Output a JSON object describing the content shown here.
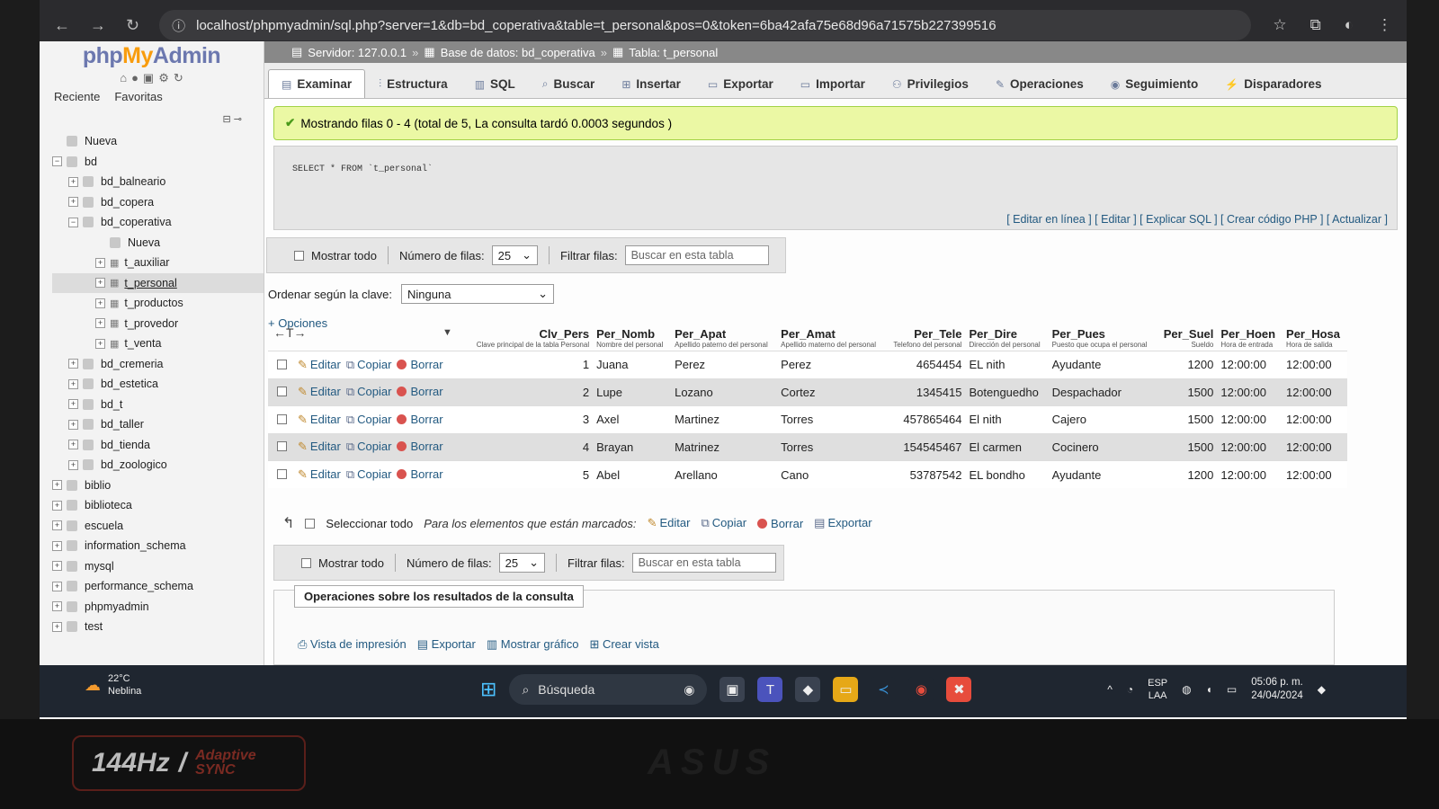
{
  "browser": {
    "url": "localhost/phpmyadmin/sql.php?server=1&db=bd_coperativa&table=t_personal&pos=0&token=6ba42afa75e68d96a71575b227399516"
  },
  "sidebar": {
    "logo_php": "php",
    "logo_my": "My",
    "logo_admin": "Admin",
    "links": [
      "Reciente",
      "Favoritas"
    ],
    "tree": [
      {
        "label": "Nueva",
        "level": 0,
        "type": "new"
      },
      {
        "label": "bd",
        "level": 0,
        "type": "db",
        "expanded": true
      },
      {
        "label": "bd_balneario",
        "level": 1,
        "type": "db"
      },
      {
        "label": "bd_copera",
        "level": 1,
        "type": "db"
      },
      {
        "label": "bd_coperativa",
        "level": 1,
        "type": "db",
        "expanded": true
      },
      {
        "label": "Nueva",
        "level": 2,
        "type": "new"
      },
      {
        "label": "t_auxiliar",
        "level": 2,
        "type": "table"
      },
      {
        "label": "t_personal",
        "level": 2,
        "type": "table",
        "selected": true
      },
      {
        "label": "t_productos",
        "level": 2,
        "type": "table"
      },
      {
        "label": "t_provedor",
        "level": 2,
        "type": "table"
      },
      {
        "label": "t_venta",
        "level": 2,
        "type": "table"
      },
      {
        "label": "bd_cremeria",
        "level": 1,
        "type": "db"
      },
      {
        "label": "bd_estetica",
        "level": 1,
        "type": "db"
      },
      {
        "label": "bd_t",
        "level": 1,
        "type": "db"
      },
      {
        "label": "bd_taller",
        "level": 1,
        "type": "db"
      },
      {
        "label": "bd_tienda",
        "level": 1,
        "type": "db"
      },
      {
        "label": "bd_zoologico",
        "level": 1,
        "type": "db"
      },
      {
        "label": "biblio",
        "level": 0,
        "type": "db"
      },
      {
        "label": "biblioteca",
        "level": 0,
        "type": "db"
      },
      {
        "label": "escuela",
        "level": 0,
        "type": "db"
      },
      {
        "label": "information_schema",
        "level": 0,
        "type": "db"
      },
      {
        "label": "mysql",
        "level": 0,
        "type": "db"
      },
      {
        "label": "performance_schema",
        "level": 0,
        "type": "db"
      },
      {
        "label": "phpmyadmin",
        "level": 0,
        "type": "db"
      },
      {
        "label": "test",
        "level": 0,
        "type": "db"
      }
    ]
  },
  "breadcrumb": {
    "server": "Servidor: 127.0.0.1",
    "database": "Base de datos: bd_coperativa",
    "table": "Tabla: t_personal"
  },
  "tabs": [
    {
      "label": "Examinar",
      "icon": "browse-icon"
    },
    {
      "label": "Estructura",
      "icon": "structure-icon"
    },
    {
      "label": "SQL",
      "icon": "sql-icon"
    },
    {
      "label": "Buscar",
      "icon": "search-icon"
    },
    {
      "label": "Insertar",
      "icon": "insert-icon"
    },
    {
      "label": "Exportar",
      "icon": "export-icon"
    },
    {
      "label": "Importar",
      "icon": "import-icon"
    },
    {
      "label": "Privilegios",
      "icon": "privileges-icon"
    },
    {
      "label": "Operaciones",
      "icon": "wrench-icon"
    },
    {
      "label": "Seguimiento",
      "icon": "tracking-icon"
    },
    {
      "label": "Disparadores",
      "icon": "triggers-icon"
    }
  ],
  "result": {
    "message": "Mostrando filas 0 - 4 (total de 5, La consulta tardó 0.0003 segundos )",
    "sql": "SELECT * FROM `t_personal`",
    "sql_links": "[ Editar en línea ] [ Editar ] [ Explicar SQL ] [ Crear código PHP ] [ Actualizar ]"
  },
  "filters": {
    "show_all": "Mostrar todo",
    "rows_label": "Número de filas:",
    "rows_value": "25",
    "filter_label": "Filtrar filas:",
    "filter_placeholder": "Buscar en esta tabla",
    "order_label": "Ordenar según la clave:",
    "order_value": "Ninguna",
    "options": "+ Opciones"
  },
  "actions": {
    "edit": "Editar",
    "copy": "Copiar",
    "delete": "Borrar"
  },
  "columns": [
    {
      "name": "Clv_Pers",
      "sub": "Clave principal de la tabla Personal",
      "num": true
    },
    {
      "name": "Per_Nomb",
      "sub": "Nombre del personal",
      "num": false
    },
    {
      "name": "Per_Apat",
      "sub": "Apellido paterno del personal",
      "num": false
    },
    {
      "name": "Per_Amat",
      "sub": "Apellido materno del personal",
      "num": false
    },
    {
      "name": "Per_Tele",
      "sub": "Telefono del personal",
      "num": true
    },
    {
      "name": "Per_Dire",
      "sub": "Dirección del personal",
      "num": false
    },
    {
      "name": "Per_Pues",
      "sub": "Puesto que ocupa el personal",
      "num": false
    },
    {
      "name": "Per_Suel",
      "sub": "Sueldo",
      "num": true
    },
    {
      "name": "Per_Hoen",
      "sub": "Hora de entrada",
      "num": false
    },
    {
      "name": "Per_Hosa",
      "sub": "Hora de salida",
      "num": false
    }
  ],
  "rows": [
    [
      "1",
      "Juana",
      "Perez",
      "Perez",
      "4654454",
      "EL nith",
      "Ayudante",
      "1200",
      "12:00:00",
      "12:00:00"
    ],
    [
      "2",
      "Lupe",
      "Lozano",
      "Cortez",
      "1345415",
      "Botenguedho",
      "Despachador",
      "1500",
      "12:00:00",
      "12:00:00"
    ],
    [
      "3",
      "Axel",
      "Martinez",
      "Torres",
      "457865464",
      "El nith",
      "Cajero",
      "1500",
      "12:00:00",
      "12:00:00"
    ],
    [
      "4",
      "Brayan",
      "Matrinez",
      "Torres",
      "154545467",
      "El carmen",
      "Cocinero",
      "1500",
      "12:00:00",
      "12:00:00"
    ],
    [
      "5",
      "Abel",
      "Arellano",
      "Cano",
      "53787542",
      "EL bondho",
      "Ayudante",
      "1200",
      "12:00:00",
      "12:00:00"
    ]
  ],
  "bulk": {
    "select_all": "Seleccionar todo",
    "marked": "Para los elementos que están marcados:",
    "export": "Exportar"
  },
  "operations": {
    "legend": "Operaciones sobre los resultados de la consulta",
    "links": [
      "Vista de impresión",
      "Exportar",
      "Mostrar gráfico",
      "Crear vista"
    ]
  },
  "taskbar": {
    "temp": "22°C",
    "weather": "Neblina",
    "search": "Búsqueda",
    "lang1": "ESP",
    "lang2": "LAA",
    "time": "05:06 p. m.",
    "date": "24/04/2024"
  },
  "bezel": {
    "hz": "144Hz",
    "adaptive": "Adaptive",
    "sync": "SYNC",
    "brand": "ASUS"
  }
}
